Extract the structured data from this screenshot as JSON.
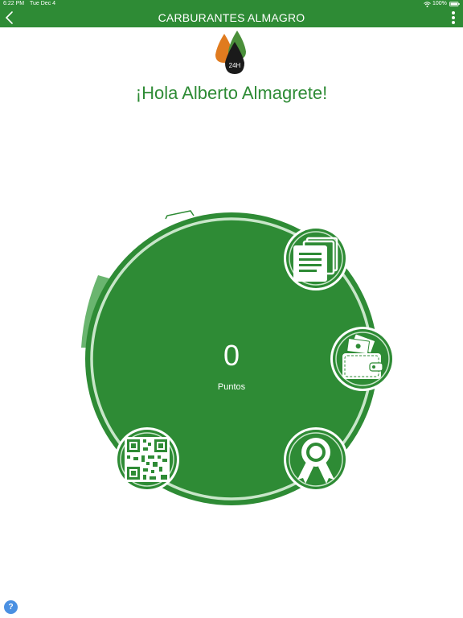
{
  "status_bar": {
    "time": "6:22 PM",
    "date": "Tue Dec 4",
    "battery": "100%",
    "wifi_icon": "wifi-icon",
    "battery_icon": "battery-icon"
  },
  "nav": {
    "title": "CARBURANTES ALMAGRO",
    "back_icon": "chevron-left-icon",
    "menu_icon": "more-vertical-icon"
  },
  "logo": {
    "text": "24H",
    "icon": "fuel-drops-logo"
  },
  "greeting": "¡Hola Alberto Almagrete!",
  "points": {
    "value": "0",
    "label": "Puntos"
  },
  "actions": [
    {
      "name": "documents-button",
      "icon": "documents-icon"
    },
    {
      "name": "wallet-button",
      "icon": "wallet-icon"
    },
    {
      "name": "rewards-button",
      "icon": "award-ribbon-icon"
    },
    {
      "name": "qr-code-button",
      "icon": "qr-code-icon"
    }
  ],
  "help": {
    "label": "?"
  },
  "colors": {
    "brand_green": "#2e8b35",
    "light_ring": "#c8e6c9",
    "orange_drop": "#e07b1f",
    "dark_drop": "#1a1a1a",
    "help_blue": "#4a90e2"
  }
}
